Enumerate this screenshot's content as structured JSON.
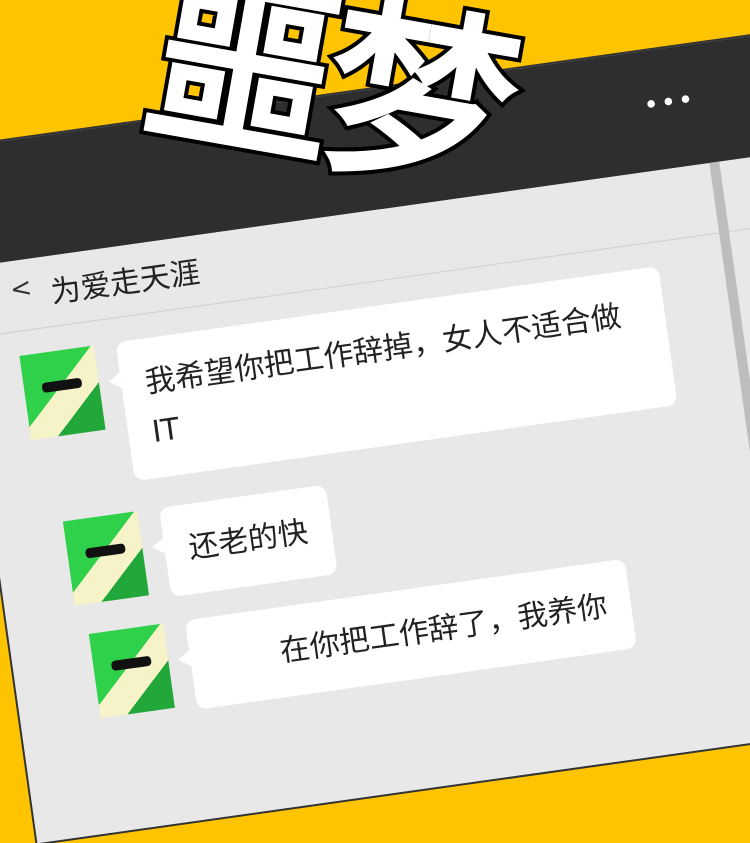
{
  "title_art": "噩梦",
  "header": {
    "more_icon": "more-dots-icon",
    "more_label": "•••",
    "back_icon": "chevron-left-icon",
    "back_label": "<",
    "contact_name": "为爱走天涯"
  },
  "messages": [
    {
      "sender": "contact",
      "text": "我希望你把工作辞掉，女人不适合做 IT"
    },
    {
      "sender": "contact",
      "text": "还老的快"
    },
    {
      "sender": "contact",
      "text": "在你把工作辞了，我养你"
    }
  ],
  "colors": {
    "background": "#FFC400",
    "topbar": "#2e2e2e",
    "chat_bg": "#e8e8e8"
  }
}
